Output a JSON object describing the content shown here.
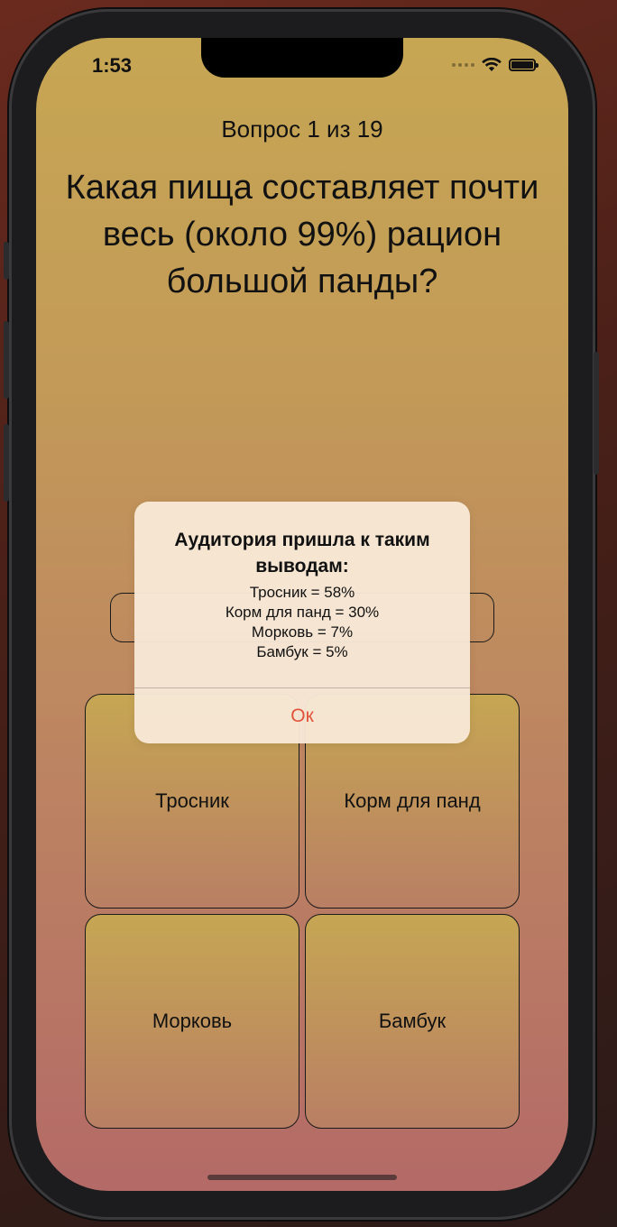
{
  "status_bar": {
    "time": "1:53"
  },
  "quiz": {
    "counter": "Вопрос 1 из 19",
    "question": "Какая пища составляет почти весь (около 99%) рацион большой панды?",
    "answers": [
      "Тросник",
      "Корм для панд",
      "Морковь",
      "Бамбук"
    ]
  },
  "alert": {
    "title": "Аудитория пришла к таким выводам:",
    "lines": [
      "Тросник = 58%",
      "Корм для панд = 30%",
      "Морковь = 7%",
      "Бамбук = 5%"
    ],
    "ok_label": "Ок"
  },
  "colors": {
    "accent": "#e1533b",
    "background_top": "#c6a653",
    "background_bottom": "#b46a67"
  },
  "icons": {
    "signal": "signal-dots-icon",
    "wifi": "wifi-icon",
    "battery": "battery-icon"
  }
}
